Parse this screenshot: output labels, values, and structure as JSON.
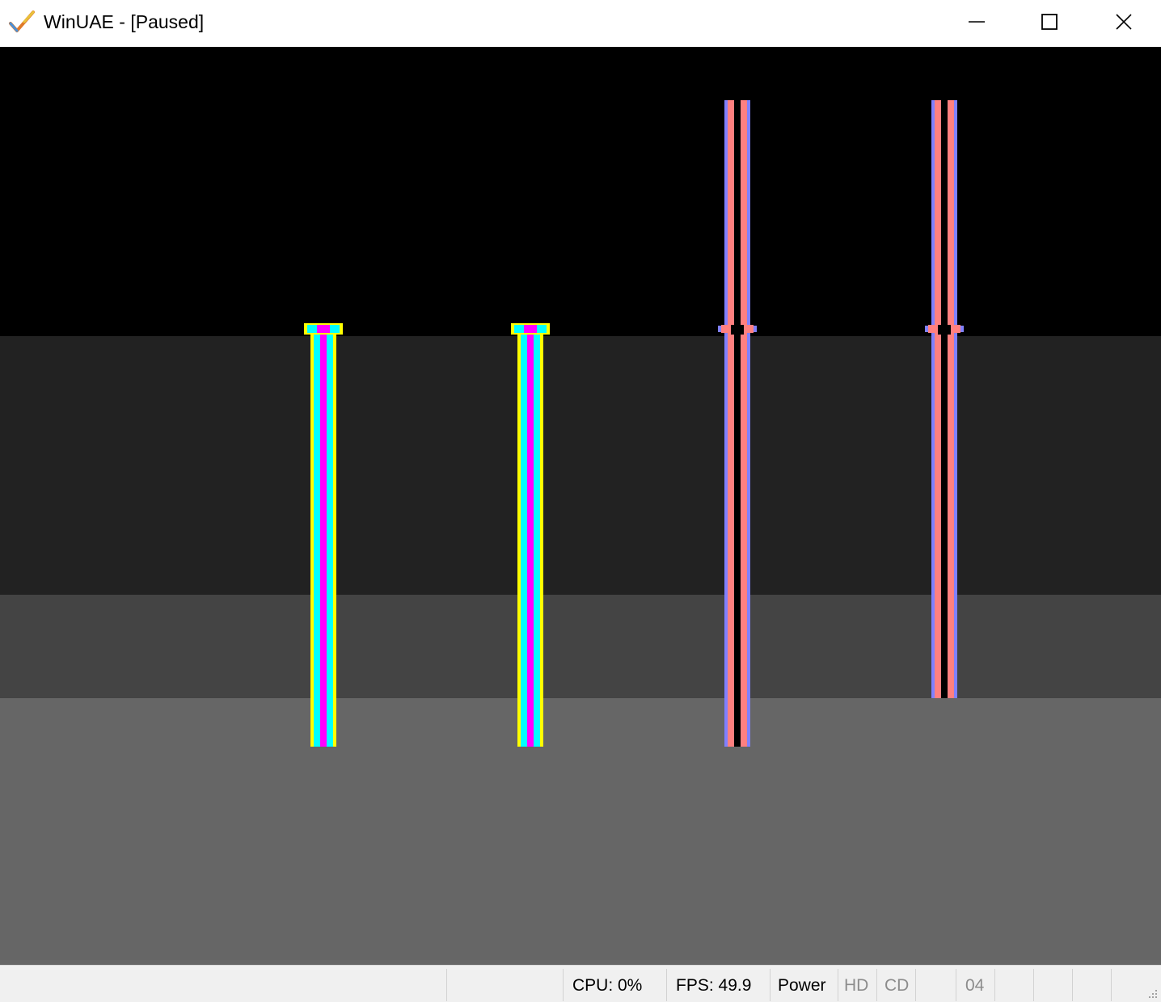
{
  "window": {
    "title": "WinUAE - [Paused]",
    "icon": "winuae-checkmark-icon",
    "controls": {
      "minimize": "minimize-icon",
      "maximize": "maximize-icon",
      "close": "close-icon"
    }
  },
  "display": {
    "state": "paused",
    "band_colors": [
      "#000000",
      "#222222",
      "#444444",
      "#666666"
    ],
    "pillar_groups": [
      {
        "name": "cyan-magenta",
        "colors": [
          "#ffff00",
          "#00ffff",
          "#ff00ff"
        ]
      },
      {
        "name": "salmon-blue",
        "colors": [
          "#8080ff",
          "#ff8080",
          "#000000"
        ]
      }
    ]
  },
  "statusbar": {
    "cpu": "CPU: 0%",
    "fps": "FPS: 49.9",
    "power": "Power",
    "hd": "HD",
    "cd": "CD",
    "drive": "04",
    "colors": {
      "active_text": "#000000",
      "inactive_text": "#8c8c8c"
    }
  }
}
